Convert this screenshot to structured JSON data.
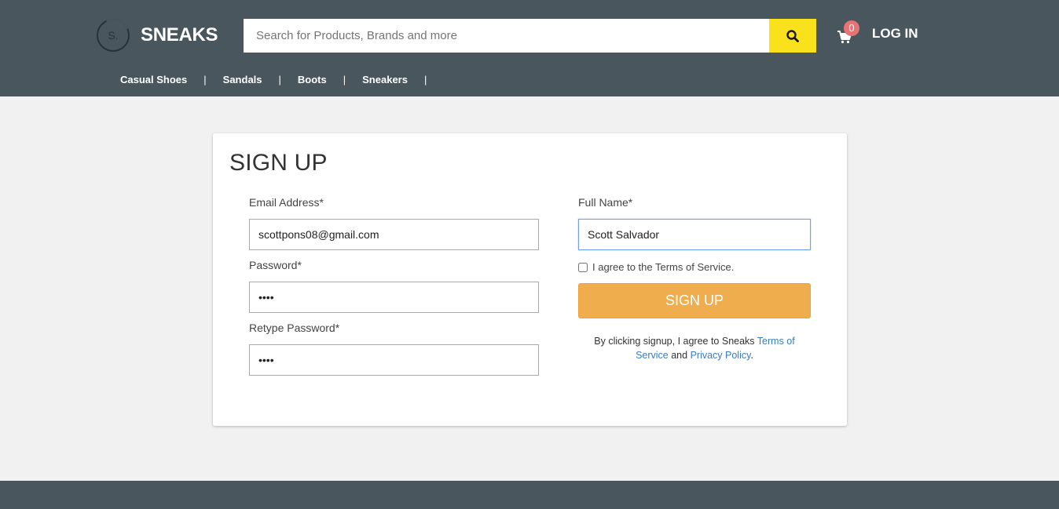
{
  "header": {
    "logo_letter": "S.",
    "brand": "SNEAKS",
    "search_placeholder": "Search for Products, Brands and more",
    "cart_count": "0",
    "login_label": "LOG IN"
  },
  "nav": {
    "items": [
      "Casual Shoes",
      "Sandals",
      "Boots",
      "Sneakers"
    ],
    "separator": "|"
  },
  "form": {
    "title": "SIGN UP",
    "email_label": "Email Address*",
    "email_value": "scottpons08@gmail.com",
    "password_label": "Password*",
    "password_value": "abcd",
    "retype_label": "Retype Password*",
    "retype_value": "abcd",
    "fullname_label": "Full Name*",
    "fullname_value": "Scott Salvador",
    "agree_label": "I agree to the Terms of Service.",
    "agree_checked": false,
    "submit_label": "SIGN UP",
    "legal_prefix": "By clicking signup, I agree to Sneaks ",
    "legal_terms": "Terms of Service",
    "legal_and": " and ",
    "legal_privacy": "Privacy Policy",
    "legal_suffix": "."
  },
  "colors": {
    "header_bg": "#4a565e",
    "search_button": "#f9e21b",
    "signup_button": "#f0ad4e",
    "link": "#3b7bbf",
    "badge": "#e57373"
  }
}
